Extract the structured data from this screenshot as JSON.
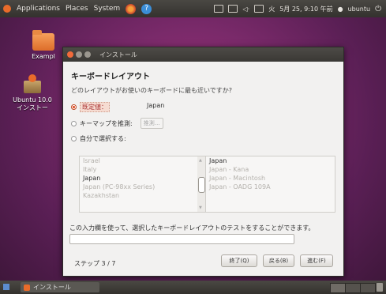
{
  "top_panel": {
    "menus": [
      "Applications",
      "Places",
      "System"
    ],
    "date_time": "5月 25, 9:10 午前",
    "day": "火",
    "user": "ubuntu"
  },
  "desktop": {
    "icons": [
      {
        "label": "Exampl"
      },
      {
        "label": "Ubuntu 10.0",
        "label2": "インストー"
      }
    ]
  },
  "window": {
    "title": "インストール",
    "heading": "キーボードレイアウト",
    "question": "どのレイアウトがお使いのキーボードに最も近いですか?",
    "options": {
      "suggested_label": "既定値：",
      "suggested_value": "Japan",
      "guess_label": "キーマップを推測:",
      "guess_button": "推測…",
      "choose_label": "自分で選択する:"
    },
    "layouts": [
      "Israel",
      "Italy",
      "Japan",
      "Japan (PC-98xx Series)",
      "Kazakhstan"
    ],
    "selected_layout": "Japan",
    "variants": [
      "Japan",
      "Japan - Kana",
      "Japan - Macintosh",
      "Japan - OADG 109A"
    ],
    "selected_variant": "Japan",
    "test_hint": "この入力欄を使って、選択したキーボードレイアウトのテストをすることができます。",
    "test_value": "",
    "step_text": "ステップ 3 / 7",
    "buttons": {
      "quit": "終了(Q)",
      "back": "戻る(B)",
      "forward": "進む(F)"
    }
  },
  "bottom_panel": {
    "task_label": "インストール"
  },
  "colors": {
    "accent": "#e0532b",
    "desktop": "#7a2a6a",
    "panel": "#3c3b37"
  }
}
